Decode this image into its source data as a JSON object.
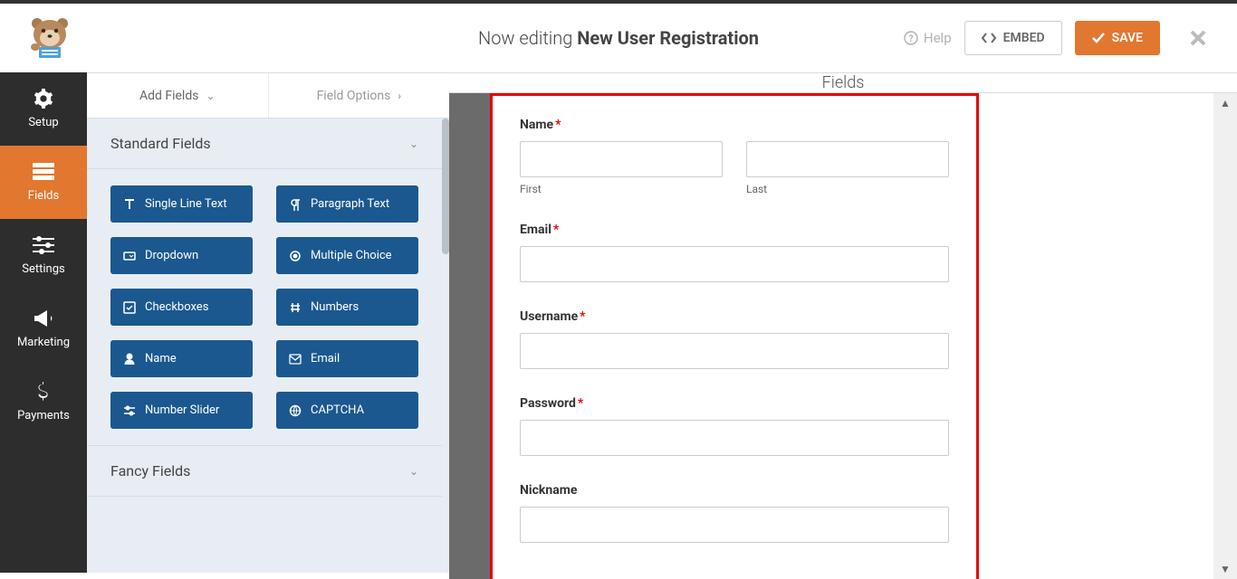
{
  "topbar": {
    "editing_prefix": "Now editing ",
    "form_name": "New User Registration",
    "help": "Help",
    "embed": "EMBED",
    "save": "SAVE"
  },
  "sidebar": {
    "items": [
      {
        "id": "setup",
        "label": "Setup"
      },
      {
        "id": "fields",
        "label": "Fields"
      },
      {
        "id": "settings",
        "label": "Settings"
      },
      {
        "id": "marketing",
        "label": "Marketing"
      },
      {
        "id": "payments",
        "label": "Payments"
      }
    ]
  },
  "panel": {
    "tab_add": "Add Fields",
    "tab_options": "Field Options",
    "section_standard": "Standard Fields",
    "section_fancy": "Fancy Fields",
    "fields": {
      "single_line": "Single Line Text",
      "paragraph": "Paragraph Text",
      "dropdown": "Dropdown",
      "multiple": "Multiple Choice",
      "checkboxes": "Checkboxes",
      "numbers": "Numbers",
      "name": "Name",
      "email": "Email",
      "slider": "Number Slider",
      "captcha": "CAPTCHA"
    }
  },
  "main": {
    "header": "Fields",
    "form": {
      "name_label": "Name",
      "first_sub": "First",
      "last_sub": "Last",
      "email_label": "Email",
      "username_label": "Username",
      "password_label": "Password",
      "nickname_label": "Nickname"
    }
  }
}
